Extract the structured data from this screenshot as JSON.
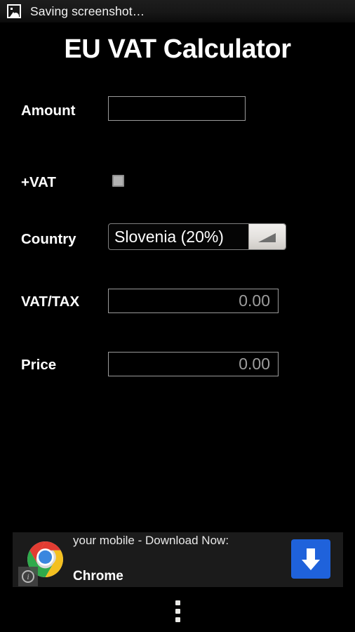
{
  "statusbar": {
    "icon": "screenshot-image-icon",
    "text": "Saving screenshot…"
  },
  "app": {
    "title": "EU VAT Calculator",
    "fields": {
      "amount": {
        "label": "Amount",
        "value": "",
        "placeholder": ""
      },
      "plus_vat": {
        "label": "+VAT",
        "checked": false
      },
      "country": {
        "label": "Country",
        "selected": "Slovenia (20%)",
        "dropdown_icon": "spinner-triangle-icon"
      },
      "vat_tax": {
        "label": "VAT/TAX",
        "value": "0.00"
      },
      "price": {
        "label": "Price",
        "value": "0.00"
      }
    }
  },
  "ad": {
    "line_top": "your mobile - Download Now:",
    "line_bottom": "Chrome",
    "brand_icon": "chrome-logo-icon",
    "cta_icon": "download-arrow-icon",
    "info_badge": "ad-info-icon",
    "cta_color": "#1f62db"
  },
  "navbar": {
    "overflow_icon": "overflow-menu-icon"
  }
}
